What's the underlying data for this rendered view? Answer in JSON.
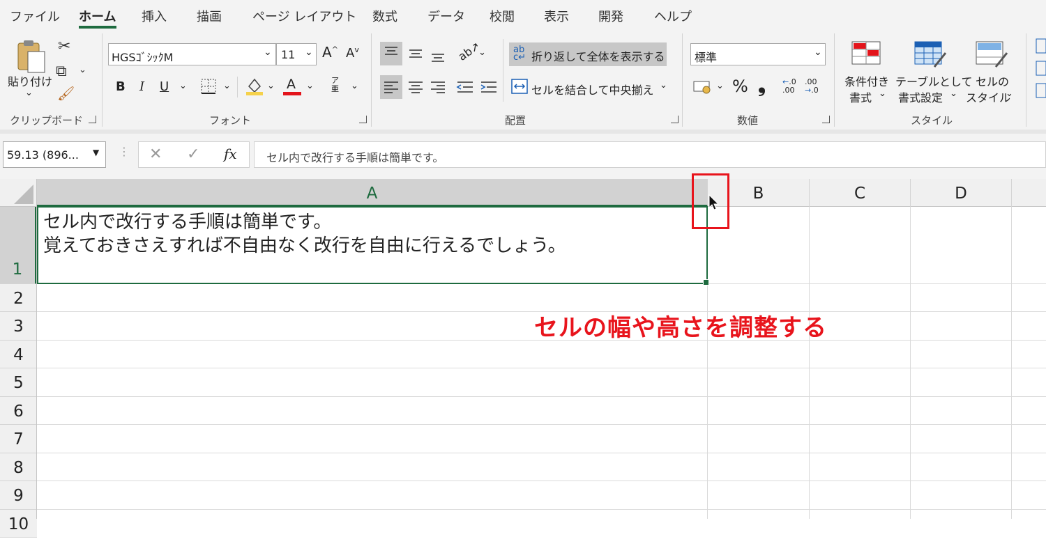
{
  "tabs": [
    "ファイル",
    "ホーム",
    "挿入",
    "描画",
    "ページ レイアウト",
    "数式",
    "データ",
    "校閲",
    "表示",
    "開発",
    "ヘルプ"
  ],
  "active_tab": "ホーム",
  "clipboard": {
    "paste_label": "貼り付け",
    "group_label": "クリップボード"
  },
  "font": {
    "font_name": "HGSｺﾞｼｯｸM",
    "font_size": "11",
    "bold": "B",
    "italic": "I",
    "underline": "U",
    "group_label": "フォント",
    "grow": "A",
    "shrink": "A",
    "font_color_glyph": "A",
    "phonetic_glyph": "ア\n亜"
  },
  "alignment": {
    "wrap_text": "折り返して全体を表示する",
    "merge_center": "セルを結合して中央揃え",
    "group_label": "配置"
  },
  "number": {
    "format": "標準",
    "percent": "%",
    "comma": "❟",
    "group_label": "数値"
  },
  "styles": {
    "conditional": [
      "条件付き",
      "書式"
    ],
    "table": [
      "テーブルとして",
      "書式設定"
    ],
    "cell": [
      "セルの",
      "スタイル"
    ],
    "group_label": "スタイル"
  },
  "name_box": "59.13 (896...",
  "formula": {
    "fx": "fx",
    "content": "セル内で改行する手順は簡単です。"
  },
  "columns": [
    "A",
    "B",
    "C",
    "D"
  ],
  "rows": [
    "1",
    "2",
    "3",
    "4",
    "5",
    "6",
    "7",
    "8",
    "9",
    "10"
  ],
  "cell_a1": {
    "line1": "セル内で改行する手順は簡単です。",
    "line2": "覚えておきさえすれば不自由なく改行を自由に行えるでしょう。"
  },
  "annotation": "セルの幅や高さを調整する",
  "colors": {
    "accent_green": "#1e6b3f",
    "annotation_red": "#e8141c",
    "ribbon_bg": "#f3f3f3"
  }
}
